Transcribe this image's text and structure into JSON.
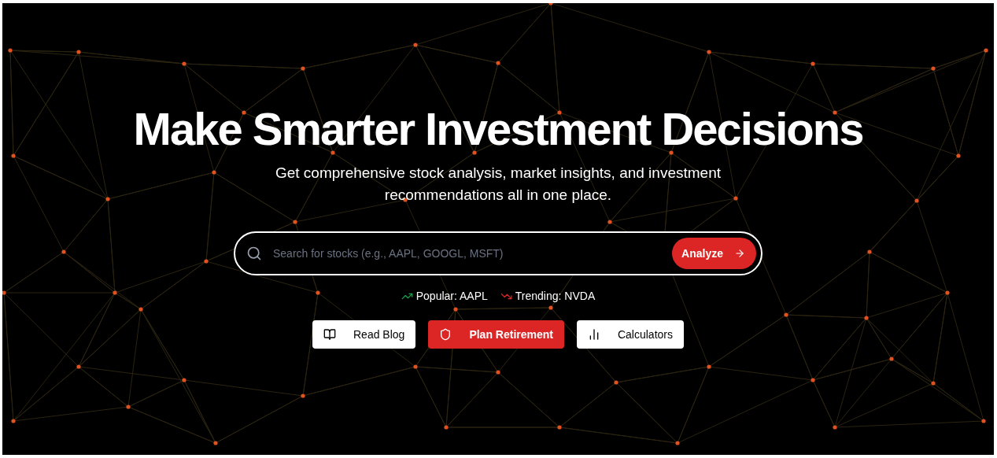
{
  "hero": {
    "title": "Make Smarter Investment Decisions",
    "subtitle": "Get comprehensive stock analysis, market insights, and investment recommendations all in one place."
  },
  "search": {
    "placeholder": "Search for stocks (e.g., AAPL, GOOGL, MSFT)",
    "button": "Analyze"
  },
  "tickers": [
    {
      "kind": "up",
      "label": "Popular: AAPL"
    },
    {
      "kind": "down",
      "label": "Trending: NVDA"
    }
  ],
  "actions": [
    {
      "kind": "book",
      "label": "Read Blog",
      "primary": false
    },
    {
      "kind": "shield",
      "label": "Plan Retirement",
      "primary": true
    },
    {
      "kind": "chart",
      "label": "Calculators",
      "primary": false
    }
  ]
}
